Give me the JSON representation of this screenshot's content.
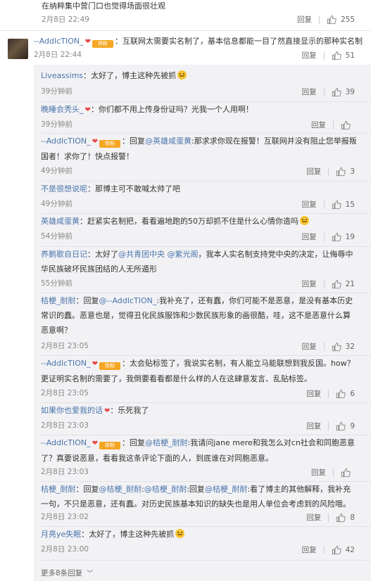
{
  "top_comment": {
    "text": "在纳粹集中营门口也觉得场面很壮观",
    "time": "2月8日 22:49",
    "reply_label": "回复",
    "likes": "255"
  },
  "main_comment": {
    "user": "--AddIcTION_",
    "badge": "铁粉",
    "text": "：互联网太需要实名制了，基本信息都能一目了然直接显示的那种实名制",
    "time": "2月8日 22:44",
    "reply_label": "回复",
    "likes": "51"
  },
  "replies": [
    {
      "user": "Liveassims",
      "text": "：太好了，博主这种先被抓",
      "time": "39分钟前",
      "likes": "39"
    },
    {
      "user": "晚睡会秃头_",
      "text": "：你们都不用上传身份证吗？光我一个人用啊！",
      "time": "39分钟前",
      "likes": ""
    },
    {
      "user": "--AddIcTION_",
      "badge": "铁粉",
      "text_pre": "：回复",
      "mention": "@英雄咸蛋黄",
      "text": ":那求求你现在报警！互联网并没有阻止您举报叛国者！求你了！快点报警！",
      "time": "49分钟前",
      "likes": "3"
    },
    {
      "user": "不是很想说呢",
      "text": "：那博主可不敢喊太帅了吧",
      "time": "49分钟前",
      "likes": "15"
    },
    {
      "user": "英雄咸蛋黄",
      "text": "：赶紧实名制把，看看遍地跑的50万却抓不住是什么心情你造吗",
      "time": "54分钟前",
      "likes": "19"
    },
    {
      "user": "养鹅歌自日记",
      "text_pre": "：太好了",
      "mention": "@共青团中央",
      "mention2": "@紫光阁",
      "text": "，我本人实名制支持党中央的决定，让侮辱中华民族破坏民族团结的人无所遁形",
      "time": "55分钟前",
      "likes": "21"
    },
    {
      "user": "桔梗_耐耐",
      "text_pre": "：回复",
      "mention": "@--AddIcTION_",
      "text": ":我补充了，还有蠢，你们可能不是恶意，是没有基本历史常识的蠢。恶意也是，觉得丑化民族服饰和少数民族形象的画很酷，哇，这不是恶意什么算恶意啊？",
      "time": "2月8日 23:05",
      "likes": "32"
    },
    {
      "user": "--AddIcTION_",
      "badge": "铁粉",
      "text": "：太会贴标签了，我说实名制，有人能立马能联想到我反国。how？更证明实名制的需要了，我倒要看看都是什么样的人在这肆意发言、乱贴标签。",
      "time": "2月8日 23:05",
      "likes": "6"
    },
    {
      "user": "如果你也爱我的话",
      "text": "：乐死我了",
      "time": "2月8日 23:03",
      "likes": "9"
    },
    {
      "user": "--AddIcTION_",
      "badge": "铁粉",
      "text_pre": "：回复",
      "mention": "@桔梗_耐耐",
      "text": ":我请问jane mere和我怎么对cn社会和同胞恶意了？真要说恶意，看看我这条评论下面的人，到底谁在对同胞恶意。",
      "time": "2月8日 23:03",
      "likes": ""
    },
    {
      "user": "桔梗_耐耐",
      "text_pre": "：回复",
      "mention": "@桔梗_耐耐",
      "mention2": "@桔梗_耐耐",
      "mention3": "@桔梗_耐耐",
      "text": ":看了博主的其他解释，我补充一句，不只是恶意，还有蠢。对历史民族基本知识的缺失也是用人单位会考虑到的风险哦。",
      "time": "2月8日 23:02",
      "likes": "8"
    },
    {
      "user": "月亮ye失眠",
      "text": "：太好了，博主这种先被抓",
      "time": "2月8日 23:00",
      "likes": "42"
    }
  ],
  "reply_label": "回复",
  "more_replies": "更多8条回复",
  "colors": {
    "username": "#4b74ab",
    "meta": "#888888",
    "panel": "#f2f2f5",
    "badge": "#f5a623"
  }
}
